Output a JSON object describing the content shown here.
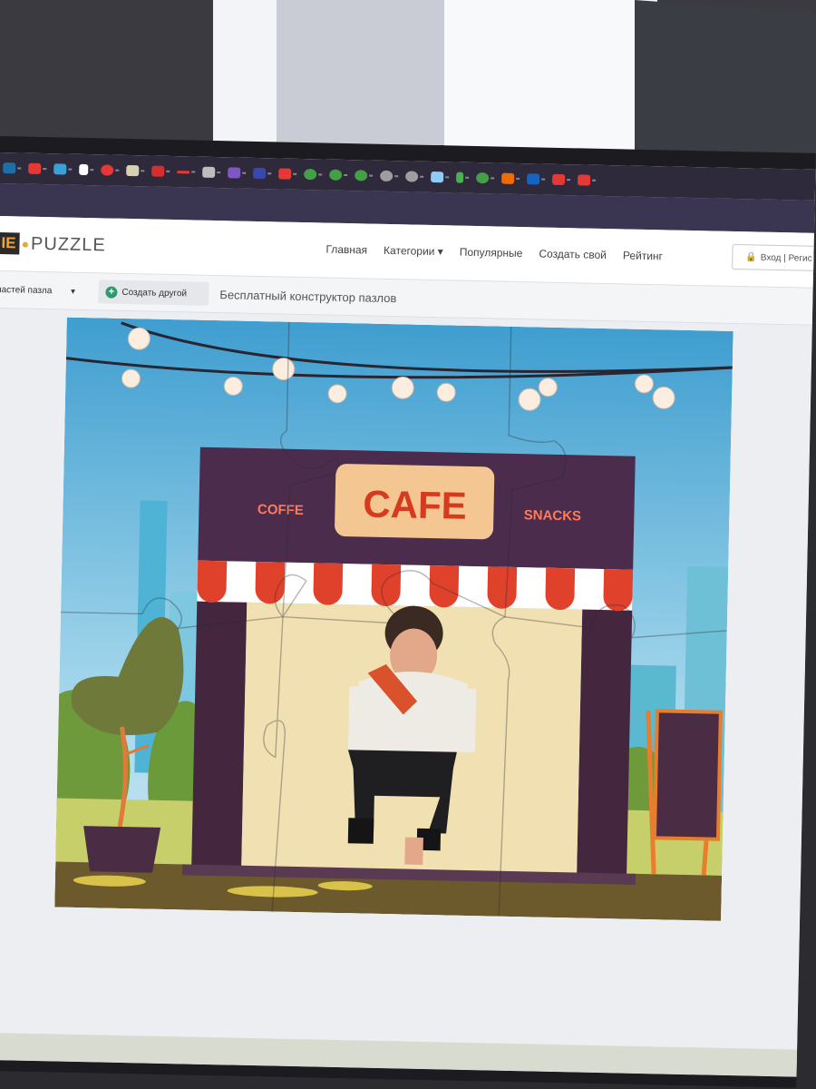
{
  "header": {
    "logo_mark": "IE",
    "logo_text": "PUZZLE"
  },
  "nav": {
    "items": [
      "Главная",
      "Категории ▾",
      "Популярные",
      "Создать свой",
      "Рейтинг"
    ],
    "login_label": "Вход | Регис"
  },
  "toolbar": {
    "pieces_label": "частей пазла",
    "create_label": "Создать другой",
    "tagline": "Бесплатный конструктор пазлов"
  },
  "puzzle": {
    "sign_main": "CAFE",
    "sign_left": "COFFE",
    "sign_right": "SNACKS"
  },
  "colors": {
    "accent": "#f2a536",
    "create_icon": "#2a9d6e"
  }
}
